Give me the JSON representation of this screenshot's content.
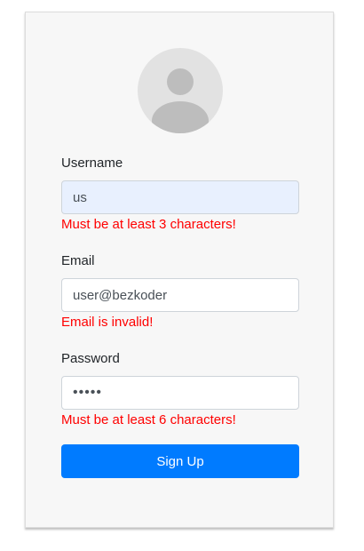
{
  "form": {
    "username": {
      "label": "Username",
      "value": "us",
      "error": "Must be at least 3 characters!"
    },
    "email": {
      "label": "Email",
      "value": "user@bezkoder",
      "error": "Email is invalid!"
    },
    "password": {
      "label": "Password",
      "value": "•••••",
      "error": "Must be at least 6 characters!"
    },
    "submit_label": "Sign Up"
  },
  "avatar_icon": "user-silhouette-icon",
  "colors": {
    "primary": "#007bff",
    "error": "#ff0000",
    "card_bg": "#f7f7f7",
    "autofill_bg": "#e8f0fe"
  }
}
